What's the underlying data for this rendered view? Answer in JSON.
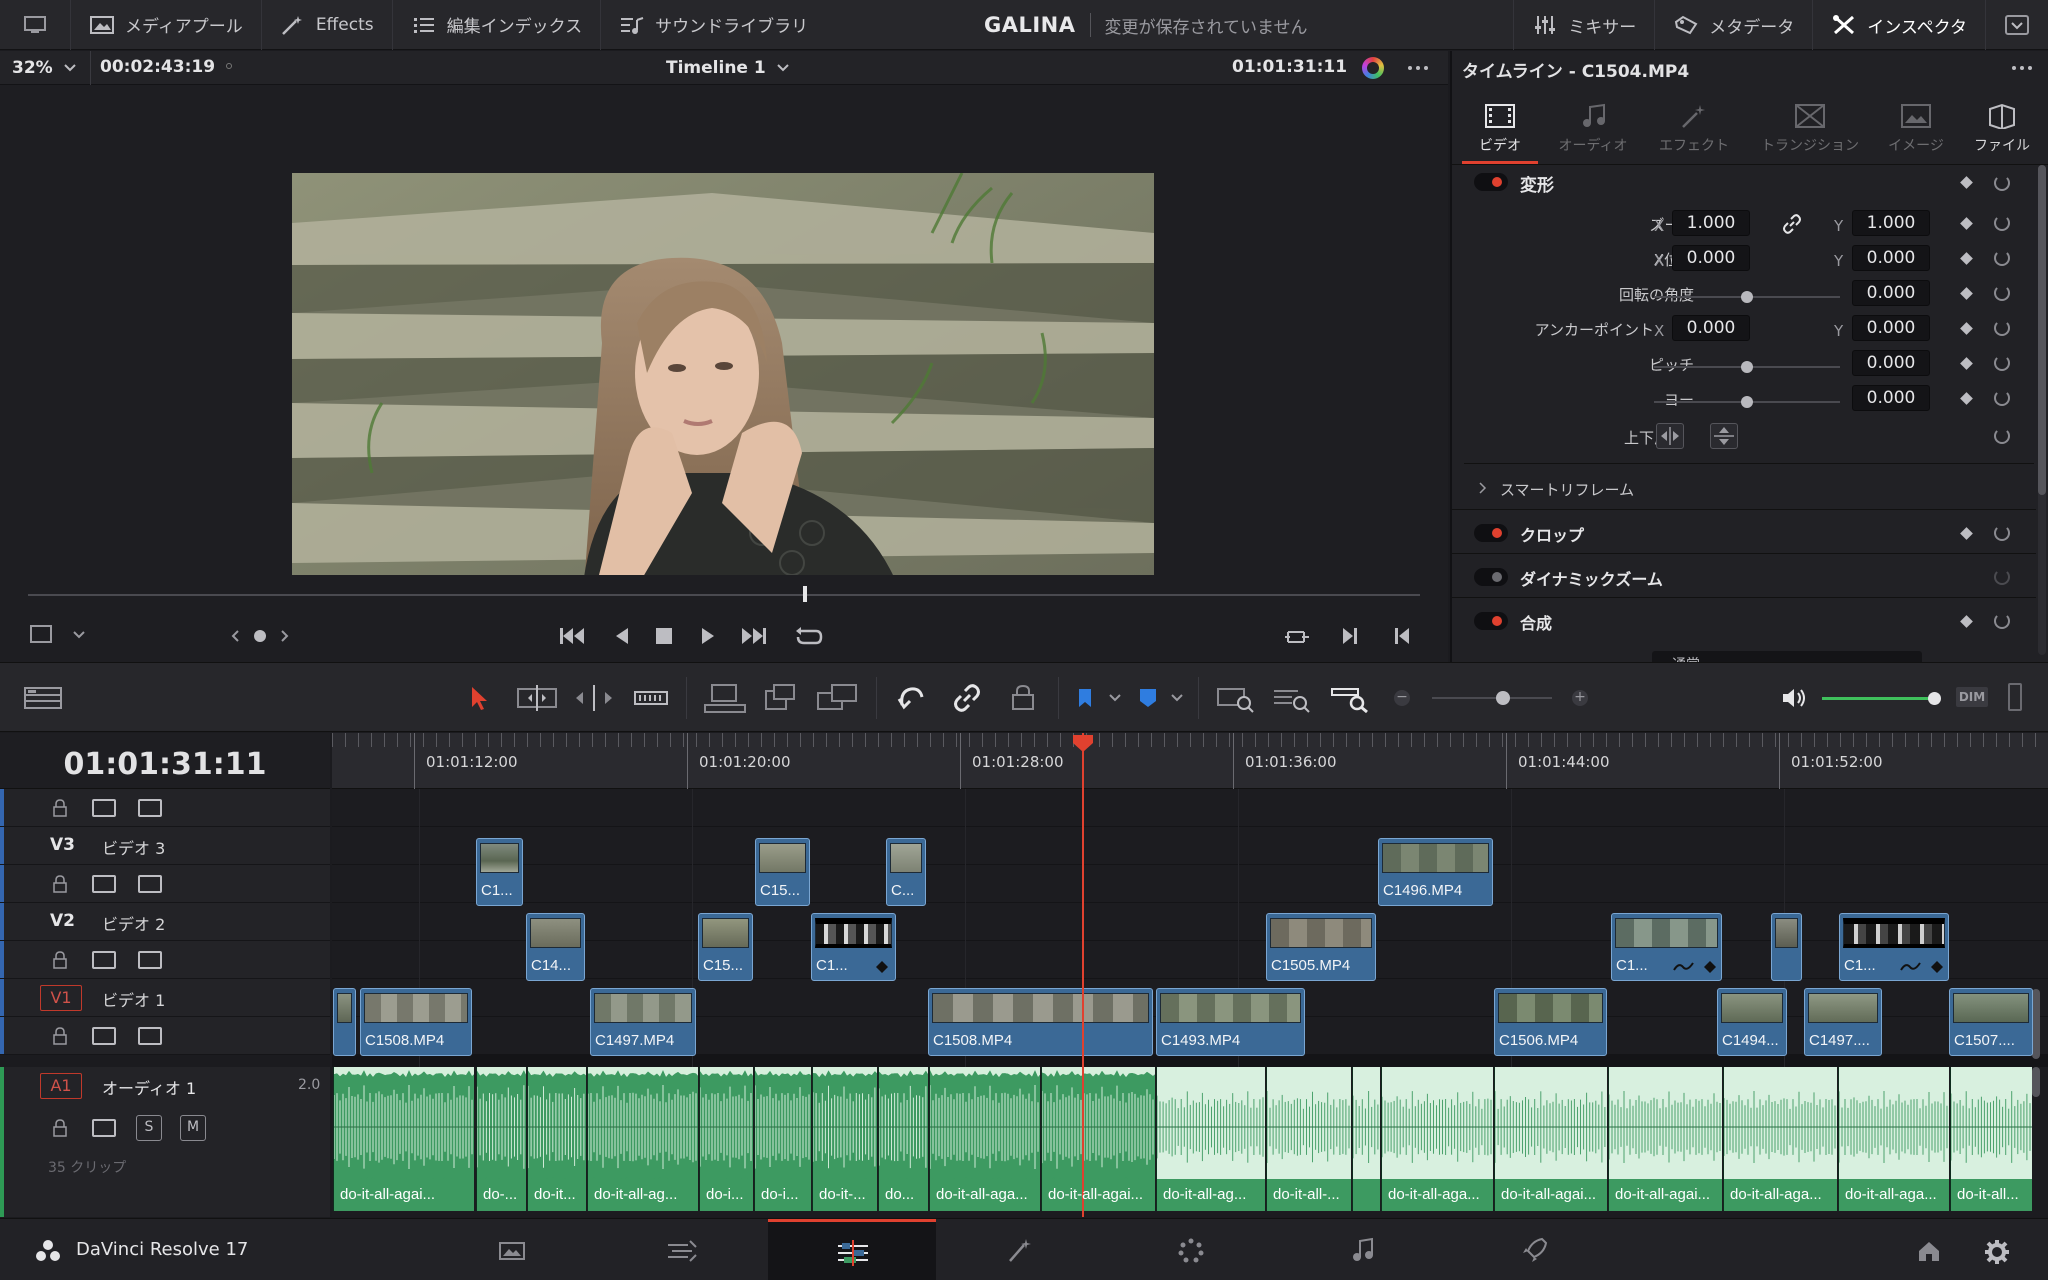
{
  "topbar": {
    "items": [
      "メディアプール",
      "Effects",
      "編集インデックス",
      "サウンドライブラリ"
    ],
    "project": "GALINA",
    "save_status": "変更が保存されていません",
    "right": [
      "ミキサー",
      "メタデータ",
      "インスペクタ"
    ]
  },
  "viewer": {
    "zoom": "32%",
    "duration": "00:02:43:19",
    "timeline_name": "Timeline 1",
    "timecode": "01:01:31:11"
  },
  "inspector": {
    "title": "タイムライン - C1504.MP4",
    "tabs": [
      "ビデオ",
      "オーディオ",
      "エフェクト",
      "トランジション",
      "イメージ",
      "ファイル"
    ],
    "transform_label": "変形",
    "zoom_label": "ズーム",
    "zoom_x": "1.000",
    "zoom_y": "1.000",
    "pos_label": "X位置",
    "pos_x": "0.000",
    "pos_y": "0.000",
    "rot_label": "回転の角度",
    "rot": "0.000",
    "anchor_label": "アンカーポイント",
    "anchor_x": "0.000",
    "anchor_y": "0.000",
    "pitch_label": "ピッチ",
    "pitch": "0.000",
    "yaw_label": "ヨー",
    "yaw": "0.000",
    "flip_label": "上下反転",
    "x": "X",
    "y": "Y",
    "smart_reframe": "スマートリフレーム",
    "crop": "クロップ",
    "dynamic_zoom": "ダイナミックズーム",
    "composite": "合成",
    "composite_mode": "通常"
  },
  "timeline": {
    "timecode": "01:01:31:11",
    "ruler": [
      "01:01:12:00",
      "01:01:20:00",
      "01:01:28:00",
      "01:01:36:00",
      "01:01:44:00",
      "01:01:52:00"
    ],
    "v3": {
      "id": "V3",
      "name": "ビデオ 3"
    },
    "v2": {
      "id": "V2",
      "name": "ビデオ 2"
    },
    "v1": {
      "id": "V1",
      "name": "ビデオ 1"
    },
    "a1": {
      "id": "A1",
      "name": "オーディオ 1",
      "channels": "2.0",
      "s": "S",
      "m": "M",
      "clips": "35 クリップ"
    },
    "v3_clips": [
      "C1...",
      "C15...",
      "C...",
      "C1496.MP4"
    ],
    "v2_clips": [
      "C14...",
      "C15...",
      "C1...",
      "C1505.MP4",
      "C1...",
      "",
      "C1..."
    ],
    "v1_clips": [
      "",
      "C1508.MP4",
      "C1497.MP4",
      "C1508.MP4",
      "C1493.MP4",
      "C1506.MP4",
      "C1494...",
      "C1497....",
      "C1507...."
    ],
    "a1_clips": [
      "do-it-all-agai...",
      "do-...",
      "do-it...",
      "do-it-all-ag...",
      "do-i...",
      "do-i...",
      "do-it-...",
      "do...",
      "do-it-all-aga...",
      "do-it-all-agai...",
      "do-it-all-ag...",
      "do-it-all-...",
      "",
      "do-it-all-aga...",
      "do-it-all-agai...",
      "do-it-all-agai...",
      "do-it-all-aga...",
      "do-it-all-aga...",
      "do-it-all..."
    ]
  },
  "bottom": {
    "app": "DaVinci Resolve 17"
  },
  "colors": {
    "accent": "#e0412f",
    "clip_video": "#3b6996",
    "clip_audio": "#3d9a61",
    "playhead": "#e0412f"
  }
}
